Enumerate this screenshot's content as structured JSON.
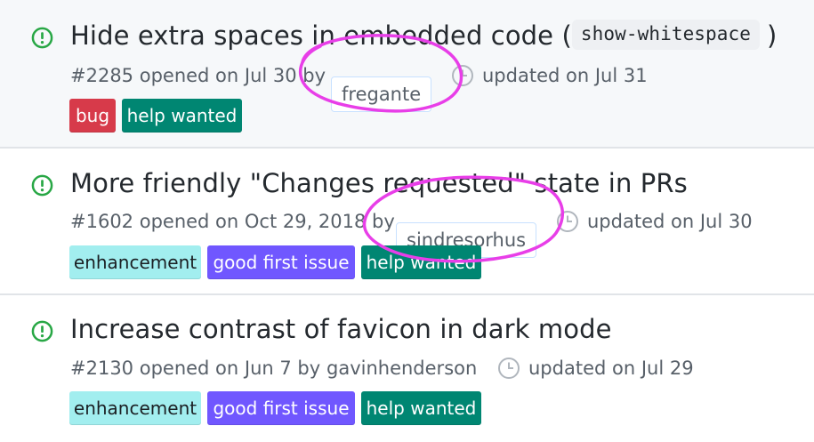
{
  "colors": {
    "open_icon": "#28a745",
    "annotation": "#e83ee8",
    "bug": "#d73a4a",
    "help_wanted": "#008672",
    "enhancement": "#a2eeef",
    "good_first_issue": "#7057ff"
  },
  "issues": [
    {
      "status_icon": "issue-opened-icon",
      "title_text": "Hide extra spaces in embedded code (",
      "title_code": "show-whitespace",
      "title_end": ")",
      "meta_prefix": "#2285 opened on Jul 30 by",
      "author": "fregante",
      "updated": "updated on Jul 31",
      "labels": [
        "bug",
        "help wanted"
      ]
    },
    {
      "status_icon": "issue-opened-icon",
      "title_text": "More friendly \"Changes requested\" state in PRs",
      "meta_prefix": "#1602 opened on Oct 29, 2018 by",
      "author": "sindresorhus",
      "updated": "updated on Jul 30",
      "labels": [
        "enhancement",
        "good first issue",
        "help wanted"
      ]
    },
    {
      "status_icon": "issue-opened-icon",
      "title_text": "Increase contrast of favicon in dark mode",
      "meta_prefix": "#2130 opened on Jun 7 by",
      "author": "gavinhenderson",
      "updated": "updated on Jul 29",
      "labels": [
        "enhancement",
        "good first issue",
        "help wanted"
      ]
    }
  ]
}
